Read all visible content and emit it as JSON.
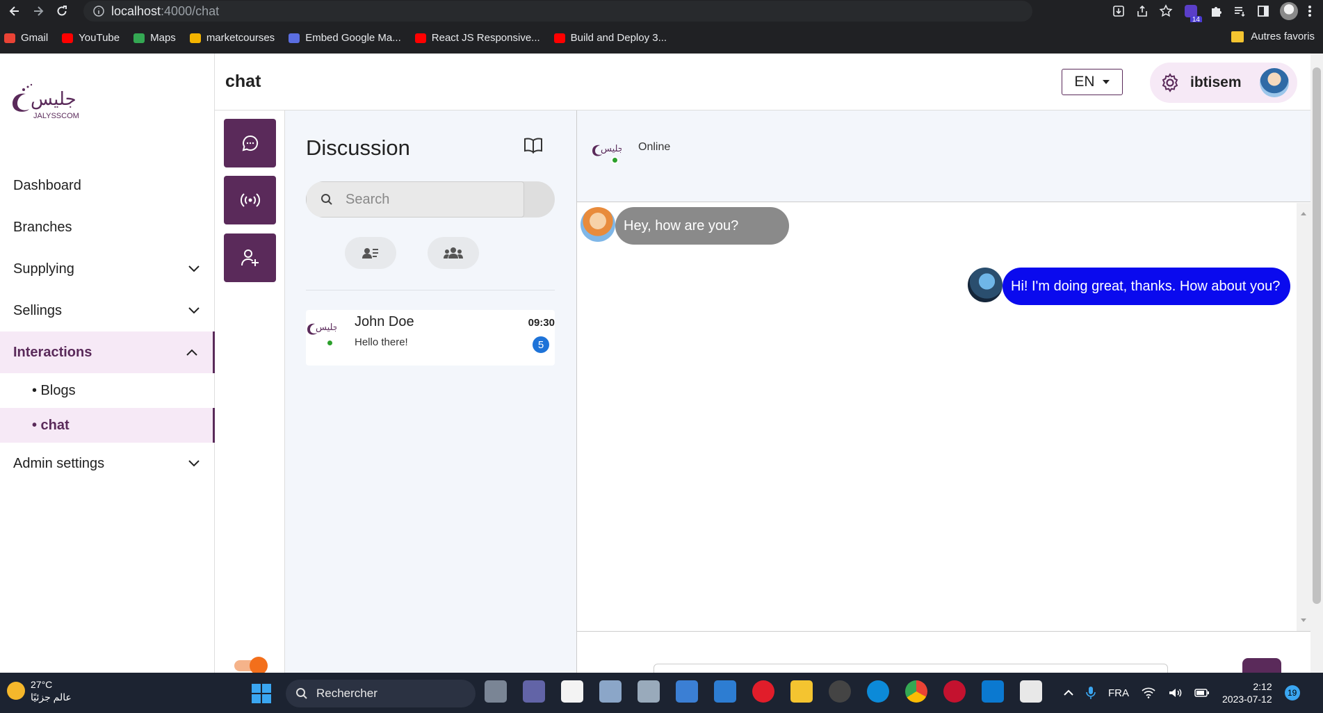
{
  "browser": {
    "url_host": "localhost",
    "url_path": ":4000/chat",
    "extension_badge": "14",
    "bookmarks": [
      {
        "label": "Gmail",
        "icon": "gmail-icon",
        "color": "#ea4335"
      },
      {
        "label": "YouTube",
        "icon": "youtube-icon",
        "color": "#ff0000"
      },
      {
        "label": "Maps",
        "icon": "maps-icon",
        "color": "#34a853"
      },
      {
        "label": "marketcourses",
        "icon": "bookmark-icon",
        "color": "#f4b400"
      },
      {
        "label": "Embed Google Ma...",
        "icon": "globe-icon",
        "color": "#5b6ee1"
      },
      {
        "label": "React JS Responsive...",
        "icon": "youtube-icon",
        "color": "#ff0000"
      },
      {
        "label": "Build and Deploy 3...",
        "icon": "youtube-icon",
        "color": "#ff0000"
      }
    ],
    "other_bookmarks": "Autres favoris"
  },
  "sidebar": {
    "logo_text": "JALYSSCOM",
    "items": [
      {
        "label": "Dashboard",
        "has_chevron": false
      },
      {
        "label": "Branches",
        "has_chevron": false
      },
      {
        "label": "Supplying",
        "has_chevron": true
      },
      {
        "label": "Sellings",
        "has_chevron": true
      },
      {
        "label": "Interactions",
        "has_chevron": true,
        "expanded": true,
        "active": true
      }
    ],
    "sub_items": [
      {
        "label": "• Blogs",
        "active": false
      },
      {
        "label": "• chat",
        "active": true
      }
    ],
    "admin": {
      "label": "Admin settings"
    }
  },
  "header": {
    "title": "chat",
    "language": "EN",
    "user_name": "ibtisem"
  },
  "discussion": {
    "title": "Discussion",
    "search_placeholder": "Search",
    "conversations": [
      {
        "name": "John Doe",
        "last_message": "Hello there!",
        "time": "09:30",
        "unread": "5",
        "online": true
      }
    ]
  },
  "chat": {
    "status": "Online",
    "messages": [
      {
        "direction": "incoming",
        "text": "Hey, how are you?"
      },
      {
        "direction": "outgoing",
        "text": "Hi! I'm doing great, thanks. How about you?"
      }
    ]
  },
  "taskbar": {
    "temperature": "27°C",
    "weather_text": "عالم جزئيًا",
    "search_label": "Rechercher",
    "language": "FRA",
    "time": "2:12",
    "date": "2023-07-12",
    "notifications": "19"
  },
  "colors": {
    "brand": "#5a2a5a",
    "active_bg": "#f6e9f6",
    "outgoing_bubble": "#0a0aee",
    "incoming_bubble": "#8a8a8a",
    "online": "#2ca02c",
    "unread_badge": "#1e73d8"
  }
}
